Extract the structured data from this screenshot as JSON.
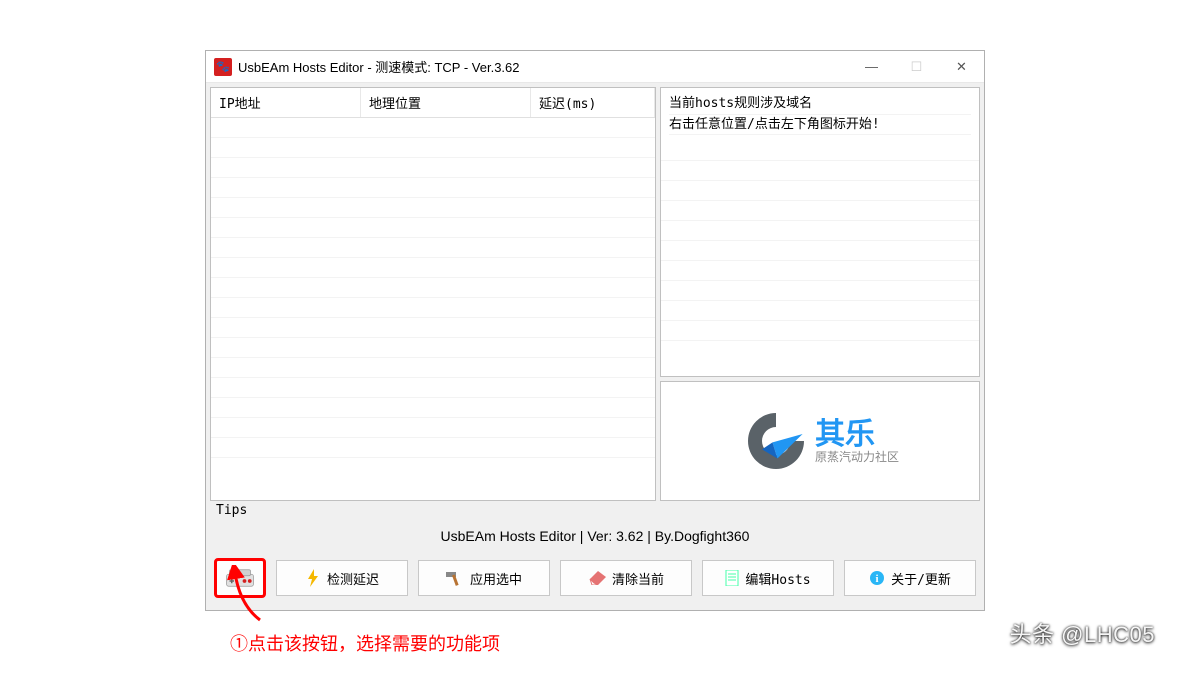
{
  "window": {
    "title": "UsbEAm Hosts Editor - 测速模式: TCP - Ver.3.62"
  },
  "table": {
    "headers": {
      "ip": "IP地址",
      "location": "地理位置",
      "latency": "延迟(ms)"
    }
  },
  "hosts_info": {
    "line1": "当前hosts规则涉及域名",
    "line2": "右击任意位置/点击左下角图标开始!"
  },
  "tips_label": "Tips",
  "info_bar": "UsbEAm Hosts Editor | Ver: 3.62 | By.Dogfight360",
  "toolbar": {
    "detect": "检测延迟",
    "apply": "应用选中",
    "clear": "清除当前",
    "edit": "编辑Hosts",
    "about": "关于/更新"
  },
  "logo": {
    "cn": "其乐",
    "sub": "原蒸汽动力社区"
  },
  "annotation": "①点击该按钮，选择需要的功能项",
  "watermark": "头条 @LHC05"
}
